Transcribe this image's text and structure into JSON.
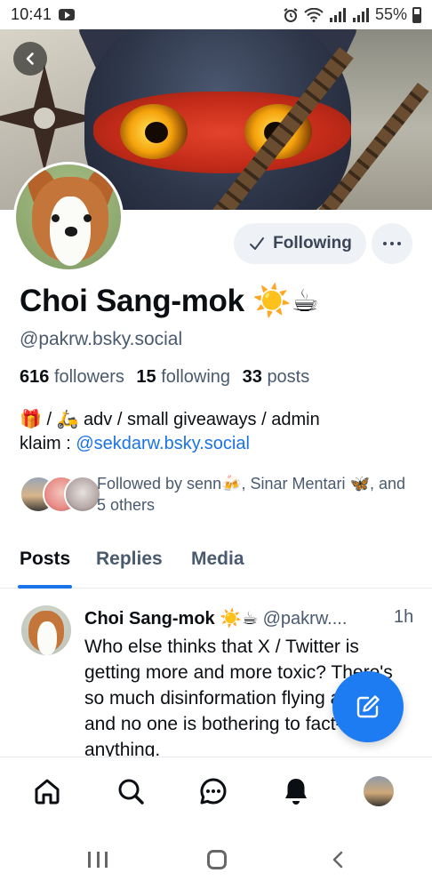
{
  "status_bar": {
    "time": "10:41",
    "battery": "55%"
  },
  "profile": {
    "display_name": "Choi Sang-mok ☀️☕",
    "handle": "@pakrw.bsky.social",
    "following_button_label": "Following",
    "stats": {
      "followers_count": "616",
      "followers_label": "followers",
      "following_count": "15",
      "following_label": "following",
      "posts_count": "33",
      "posts_label": "posts"
    },
    "bio_line1": "🎁 / 🛵 adv / small giveaways / admin",
    "bio_prefix": "klaim : ",
    "bio_link": "@sekdarw.bsky.social",
    "followed_by": "Followed by senn🍻, Sinar Mentari 🦋, and 5 others"
  },
  "tabs": [
    {
      "label": "Posts",
      "active": true
    },
    {
      "label": "Replies",
      "active": false
    },
    {
      "label": "Media",
      "active": false
    }
  ],
  "post": {
    "author": "Choi Sang-mok ☀️☕",
    "handle": "@pakrw....",
    "time": "1h",
    "text": "Who else thinks that X / Twitter is getting more and more toxic? There's so much disinformation flying around, and no one is bothering to fact-check anything."
  },
  "bottom_nav": [
    "home-icon",
    "search-icon",
    "chat-icon",
    "bell-icon",
    "profile-avatar"
  ],
  "colors": {
    "accent": "#1d7cf2",
    "link": "#1a73e8",
    "secondary_text": "#4a5a6e"
  }
}
